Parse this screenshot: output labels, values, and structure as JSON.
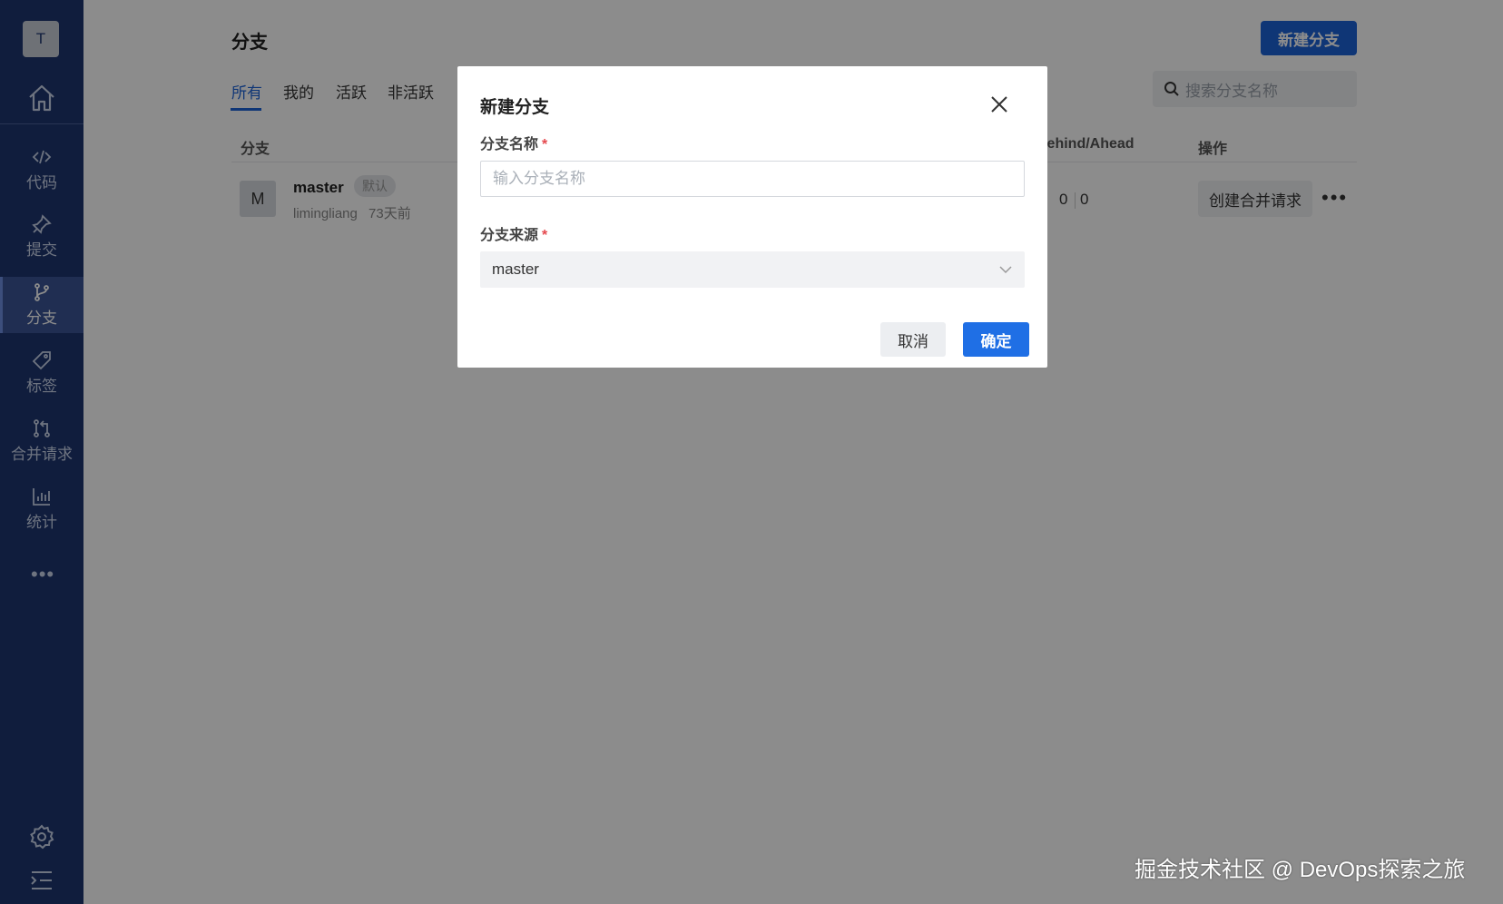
{
  "sidebar": {
    "avatar_letter": "T",
    "items": [
      {
        "label": "代码",
        "icon": "code-icon"
      },
      {
        "label": "提交",
        "icon": "pin-icon"
      },
      {
        "label": "分支",
        "icon": "branch-icon",
        "active": true
      },
      {
        "label": "标签",
        "icon": "tag-icon"
      },
      {
        "label": "合并请求",
        "icon": "merge-request-icon"
      },
      {
        "label": "统计",
        "icon": "chart-icon"
      }
    ],
    "more_label": "•••"
  },
  "page": {
    "title": "分支",
    "new_branch_button": "新建分支",
    "tabs": [
      "所有",
      "我的",
      "活跃",
      "非活跃"
    ],
    "search_placeholder": "搜索分支名称"
  },
  "table": {
    "headers": {
      "branch": "分支",
      "behind_ahead": "Behind/Ahead",
      "actions": "操作"
    },
    "rows": [
      {
        "avatar": "M",
        "name": "master",
        "badge": "默认",
        "author": "limingliang",
        "time": "73天前",
        "behind": "0",
        "ahead": "0",
        "action_button": "创建合并请求",
        "more": "•••"
      }
    ]
  },
  "modal": {
    "title": "新建分支",
    "name_label": "分支名称",
    "name_placeholder": "输入分支名称",
    "source_label": "分支来源",
    "source_value": "master",
    "required_mark": "*",
    "cancel": "取消",
    "confirm": "确定"
  },
  "watermark": "掘金技术社区 @ DevOps探索之旅",
  "colors": {
    "sidebar_bg": "#1e3670",
    "accent": "#1d63d8",
    "required": "#e5484d"
  }
}
